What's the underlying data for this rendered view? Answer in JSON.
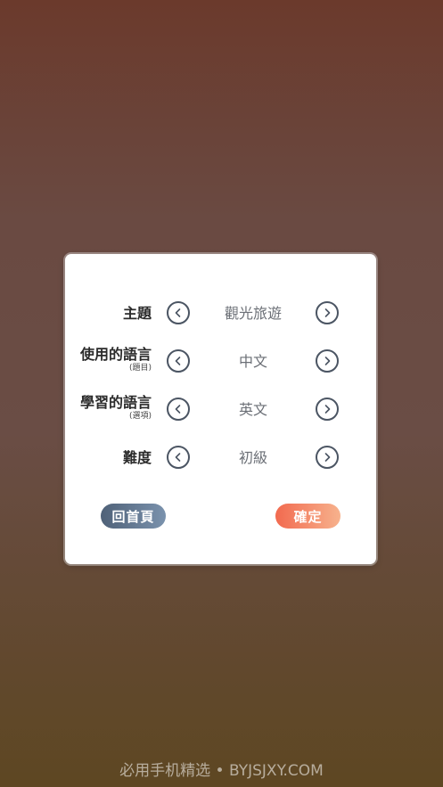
{
  "settings": {
    "rows": [
      {
        "label": "主題",
        "sub": "",
        "value": "觀光旅遊"
      },
      {
        "label": "使用的語言",
        "sub": "(題目)",
        "value": "中文"
      },
      {
        "label": "學習的語言",
        "sub": "(選項)",
        "value": "英文"
      },
      {
        "label": "難度",
        "sub": "",
        "value": "初級"
      }
    ]
  },
  "buttons": {
    "home_label": "回首頁",
    "confirm_label": "確定"
  },
  "watermark": "必用手机精选 • BYJSJXY.COM",
  "colors": {
    "home_button": "#5f7390",
    "confirm_button": "#f4876a",
    "arrow_icon": "#4b5563"
  }
}
